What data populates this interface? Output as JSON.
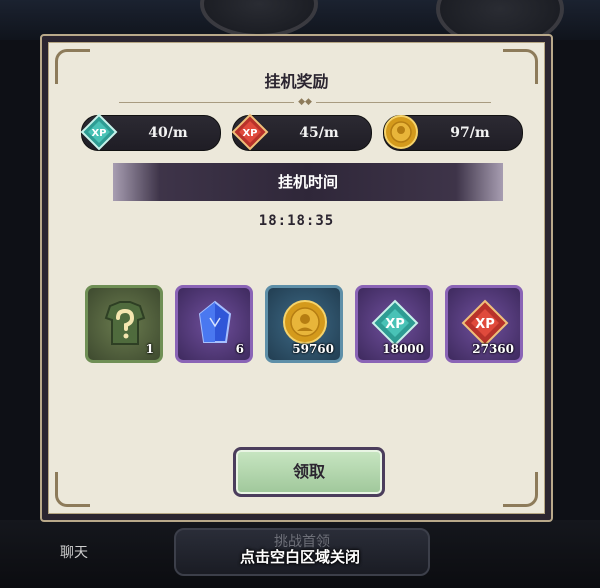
{
  "background": {
    "chat_label": "聊天",
    "challenge_label": "挑战首领"
  },
  "dialog": {
    "title": "挂机奖励",
    "rates": [
      {
        "icon": "teal-xp-gem-icon",
        "value": "40/m"
      },
      {
        "icon": "red-xp-gem-icon",
        "value": "45/m"
      },
      {
        "icon": "gold-coin-icon",
        "value": "97/m"
      }
    ],
    "idle_time_label": "挂机时间",
    "idle_time": "18:18:35",
    "rewards": [
      {
        "icon": "mystery-equipment-icon",
        "count": "1",
        "frame": "green"
      },
      {
        "icon": "blue-crystal-icon",
        "count": "6",
        "frame": "purple"
      },
      {
        "icon": "gold-coin-icon",
        "count": "59760",
        "frame": "blue"
      },
      {
        "icon": "teal-xp-gem-icon",
        "count": "18000",
        "frame": "purple"
      },
      {
        "icon": "red-xp-gem-icon",
        "count": "27360",
        "frame": "purple"
      }
    ],
    "claim_label": "领取"
  },
  "close_hint": "点击空白区域关闭",
  "colors": {
    "panel": "#ece8da",
    "frame_dark": "#2b2530",
    "claim_button": "#b3d8ad",
    "purple_frame": "#8a64b6",
    "green_frame": "#6f8f55",
    "blue_frame": "#5e8fa8"
  }
}
